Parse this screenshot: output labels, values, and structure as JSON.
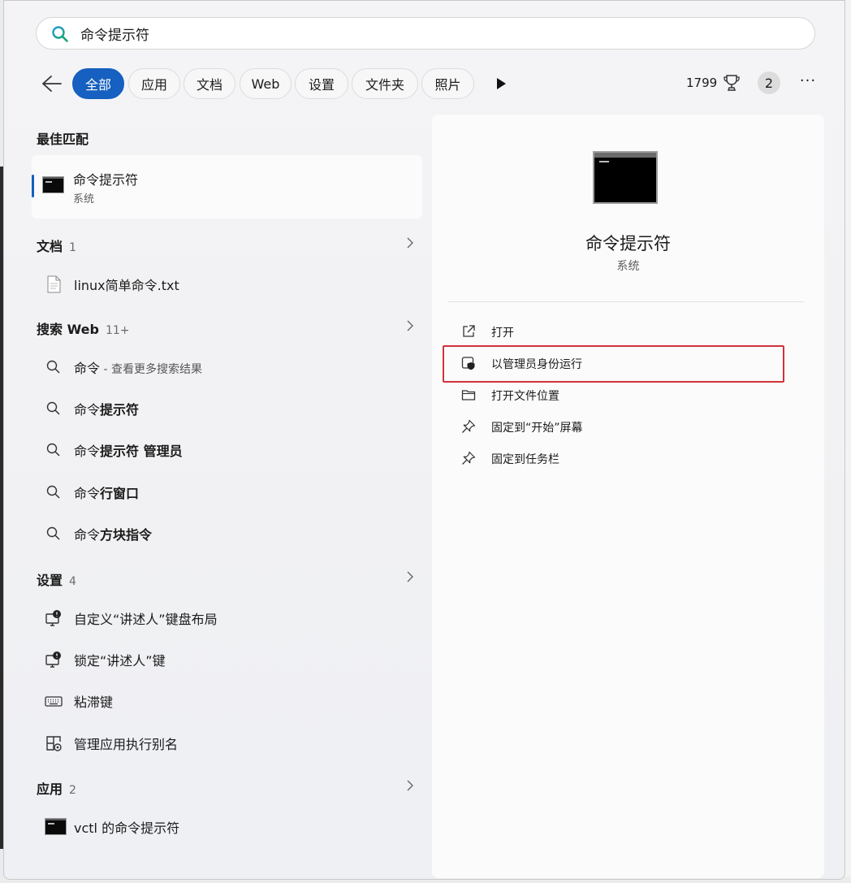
{
  "search": {
    "value": "命令提示符"
  },
  "filters": {
    "tabs": [
      "全部",
      "应用",
      "文档",
      "Web",
      "设置",
      "文件夹",
      "照片"
    ],
    "active": "全部",
    "points": "1799",
    "badge": "2",
    "more": "···"
  },
  "best_match": {
    "title": "最佳匹配",
    "name": "命令提示符",
    "sub": "系统"
  },
  "documents": {
    "title": "文档",
    "count": "1",
    "items": [
      "linux简单命令.txt"
    ]
  },
  "web": {
    "title": "搜索 Web",
    "count": "11+",
    "items": [
      {
        "prefix": "命令",
        "bold": "",
        "hint": " - 查看更多搜索结果"
      },
      {
        "prefix": "命令",
        "bold": "提示符",
        "hint": ""
      },
      {
        "prefix": "命令",
        "bold": "提示符 管理员",
        "hint": ""
      },
      {
        "prefix": "命令",
        "bold": "行窗口",
        "hint": ""
      },
      {
        "prefix": "命令",
        "bold": "方块指令",
        "hint": ""
      }
    ]
  },
  "settings": {
    "title": "设置",
    "count": "4",
    "items": [
      "自定义“讲述人”键盘布局",
      "锁定“讲述人”键",
      "粘滞键",
      "管理应用执行别名"
    ]
  },
  "apps": {
    "title": "应用",
    "count": "2",
    "items": [
      "vctl 的命令提示符"
    ]
  },
  "detail": {
    "title": "命令提示符",
    "sub": "系统",
    "actions": [
      "打开",
      "以管理员身份运行",
      "打开文件位置",
      "固定到“开始”屏幕",
      "固定到任务栏"
    ]
  },
  "colors": {
    "accent": "#1560c0",
    "highlight": "#d0323c"
  }
}
